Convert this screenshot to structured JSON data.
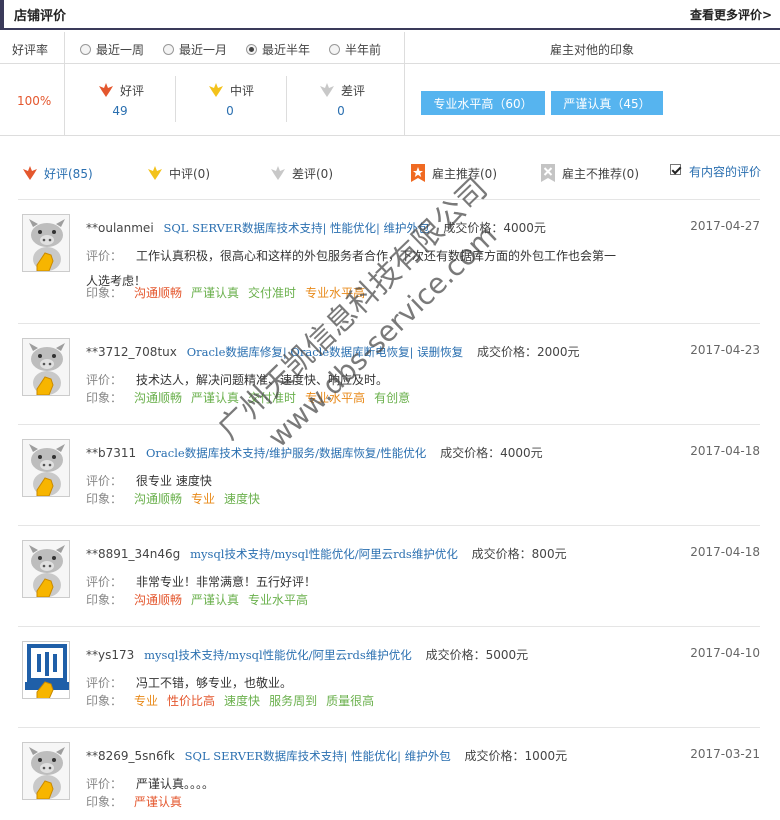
{
  "header": {
    "title": "店铺评价",
    "more": "查看更多评价>"
  },
  "summary": {
    "rate_label": "好评率",
    "rate_value": "100%",
    "periods": [
      {
        "label": "最近一周",
        "selected": false
      },
      {
        "label": "最近一月",
        "selected": false
      },
      {
        "label": "最近半年",
        "selected": true
      },
      {
        "label": "半年前",
        "selected": false
      }
    ],
    "stats": [
      {
        "label": "好评",
        "value": "49",
        "icon": "flower-icon",
        "color": "#e4572e"
      },
      {
        "label": "中评",
        "value": "0",
        "icon": "flower-icon",
        "color": "#f3c21b"
      },
      {
        "label": "差评",
        "value": "0",
        "icon": "flower-icon",
        "color": "#c4c4c4"
      }
    ],
    "impression_title": "雇主对他的印象",
    "impression_tags": [
      "专业水平高（60）",
      "严谨认真（45）"
    ]
  },
  "filters": [
    {
      "label": "好评(85)",
      "icon": "red-flower-icon"
    },
    {
      "label": "中评(0)",
      "icon": "yellow-flower-icon"
    },
    {
      "label": "差评(0)",
      "icon": "gray-flower-icon"
    },
    {
      "label": "雇主推荐(0)",
      "icon": "orange-star-badge-icon"
    },
    {
      "label": "雇主不推荐(0)",
      "icon": "gray-x-badge-icon"
    },
    {
      "label": "有内容的评价",
      "checked": true
    }
  ],
  "labels": {
    "comment": "评价：",
    "impression": "印象："
  },
  "reviews": [
    {
      "user": "**oulanmei",
      "service": "SQL SERVER数据库技术支持| 性能优化| 维护外包",
      "price": "成交价格：4000元",
      "date": "2017-04-27",
      "comment": "工作认真积极，很高心和这样的外包服务者合作，下次还有数据库方面的外包工作也会第一人选考虑！",
      "avatar": "pig",
      "tags": [
        {
          "text": "沟通顺畅",
          "color": "#e4572e"
        },
        {
          "text": "严谨认真",
          "color": "#6ab04c"
        },
        {
          "text": "交付准时",
          "color": "#6ab04c"
        },
        {
          "text": "专业水平高",
          "color": "#e88a1a"
        }
      ]
    },
    {
      "user": "**3712_708tux",
      "service": "Oracle数据库修复| Oracle数据库断电恢复| 误删恢复",
      "price": "成交价格：2000元",
      "date": "2017-04-23",
      "comment": "技术达人，解决问题精准、速度快、响应及时。",
      "avatar": "pig",
      "tags": [
        {
          "text": "沟通顺畅",
          "color": "#6ab04c"
        },
        {
          "text": "严谨认真",
          "color": "#6ab04c"
        },
        {
          "text": "交付准时",
          "color": "#6ab04c"
        },
        {
          "text": "专业水平高",
          "color": "#e88a1a"
        },
        {
          "text": "有创意",
          "color": "#6ab04c"
        }
      ]
    },
    {
      "user": "**b7311",
      "service": "Oracle数据库技术支持/维护服务/数据库恢复/性能优化",
      "price": "成交价格：4000元",
      "date": "2017-04-18",
      "comment": "很专业 速度快",
      "avatar": "pig",
      "tags": [
        {
          "text": "沟通顺畅",
          "color": "#6ab04c"
        },
        {
          "text": "专业",
          "color": "#e88a1a"
        },
        {
          "text": "速度快",
          "color": "#6ab04c"
        }
      ]
    },
    {
      "user": "**8891_34n46g",
      "service": "mysql技术支持/mysql性能优化/阿里云rds维护优化",
      "price": "成交价格：800元",
      "date": "2017-04-18",
      "comment": "非常专业！非常满意！五行好评！",
      "avatar": "pig",
      "tags": [
        {
          "text": "沟通顺畅",
          "color": "#e4572e"
        },
        {
          "text": "严谨认真",
          "color": "#6ab04c"
        },
        {
          "text": "专业水平高",
          "color": "#6ab04c"
        }
      ]
    },
    {
      "user": "**ys173",
      "service": "mysql技术支持/mysql性能优化/阿里云rds维护优化",
      "price": "成交价格：5000元",
      "date": "2017-04-10",
      "comment": "冯工不错，够专业，也敬业。",
      "avatar": "logo",
      "tags": [
        {
          "text": "专业",
          "color": "#e88a1a"
        },
        {
          "text": "性价比高",
          "color": "#e4572e"
        },
        {
          "text": "速度快",
          "color": "#6ab04c"
        },
        {
          "text": "服务周到",
          "color": "#6ab04c"
        },
        {
          "text": "质量很高",
          "color": "#6ab04c"
        }
      ]
    },
    {
      "user": "**8269_5sn6fk",
      "service": "SQL SERVER数据库技术支持| 性能优化| 维护外包",
      "price": "成交价格：1000元",
      "date": "2017-03-21",
      "comment": "严谨认真。。。。",
      "avatar": "pig",
      "tags": [
        {
          "text": "严谨认真",
          "color": "#e4572e"
        }
      ]
    }
  ],
  "watermark": {
    "line1": "广州天凯信息科技有限公司",
    "line2": "www.dbs-service.com"
  }
}
